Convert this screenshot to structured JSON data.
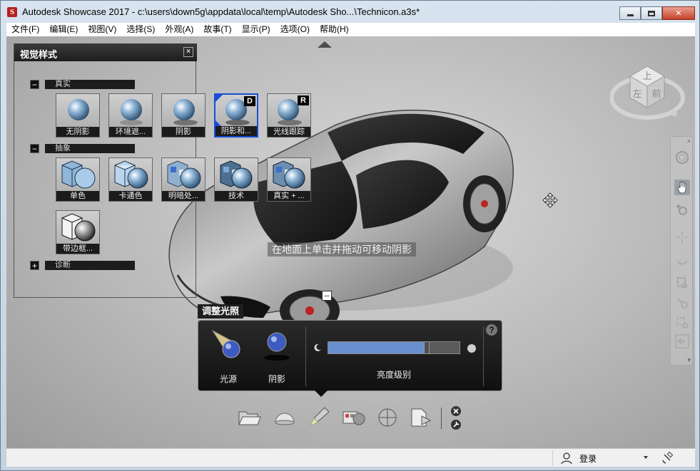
{
  "window": {
    "app_icon": "S",
    "title": "Autodesk Showcase 2017 - c:\\users\\down5g\\appdata\\local\\temp\\Autodesk Sho...\\Technicon.a3s*",
    "close_glyph": "✕"
  },
  "menu": [
    "文件(F)",
    "编辑(E)",
    "视图(V)",
    "选择(S)",
    "外观(A)",
    "故事(T)",
    "显示(P)",
    "选项(O)",
    "帮助(H)"
  ],
  "visual_style_panel": {
    "title": "视觉样式",
    "close_glyph": "×",
    "sections": [
      {
        "toggle": "−",
        "label": "真实"
      },
      {
        "toggle": "−",
        "label": "抽象"
      },
      {
        "toggle": "+",
        "label": "诊断"
      }
    ],
    "realistic_items": [
      {
        "label": "无阴影"
      },
      {
        "label": "环境遮..."
      },
      {
        "label": "阴影"
      },
      {
        "label": "阴影和...",
        "badge": "D",
        "selected": true
      },
      {
        "label": "光线跟踪",
        "badge": "R"
      }
    ],
    "abstract_items": [
      {
        "label": "单色"
      },
      {
        "label": "卡通色"
      },
      {
        "label": "明暗处..."
      },
      {
        "label": "技术"
      },
      {
        "label": "真实 + ..."
      },
      {
        "label": "带边框..."
      }
    ]
  },
  "viewport": {
    "hint": "在地面上单击并拖动可移动阴影",
    "viewcube": {
      "top": "上",
      "left": "左",
      "front": "前"
    }
  },
  "lighting_panel": {
    "title": "调整光照",
    "help": "?",
    "light_source_label": "光源",
    "shadow_label": "阴影",
    "brightness_label": "亮度级别",
    "brightness_level": 0.73
  },
  "statusbar": {
    "login": "登录"
  },
  "colors": {
    "accent_blue": "#6a8fcf",
    "selected_border": "#1a4dd6",
    "panel_dark": "#1e1e1e"
  }
}
